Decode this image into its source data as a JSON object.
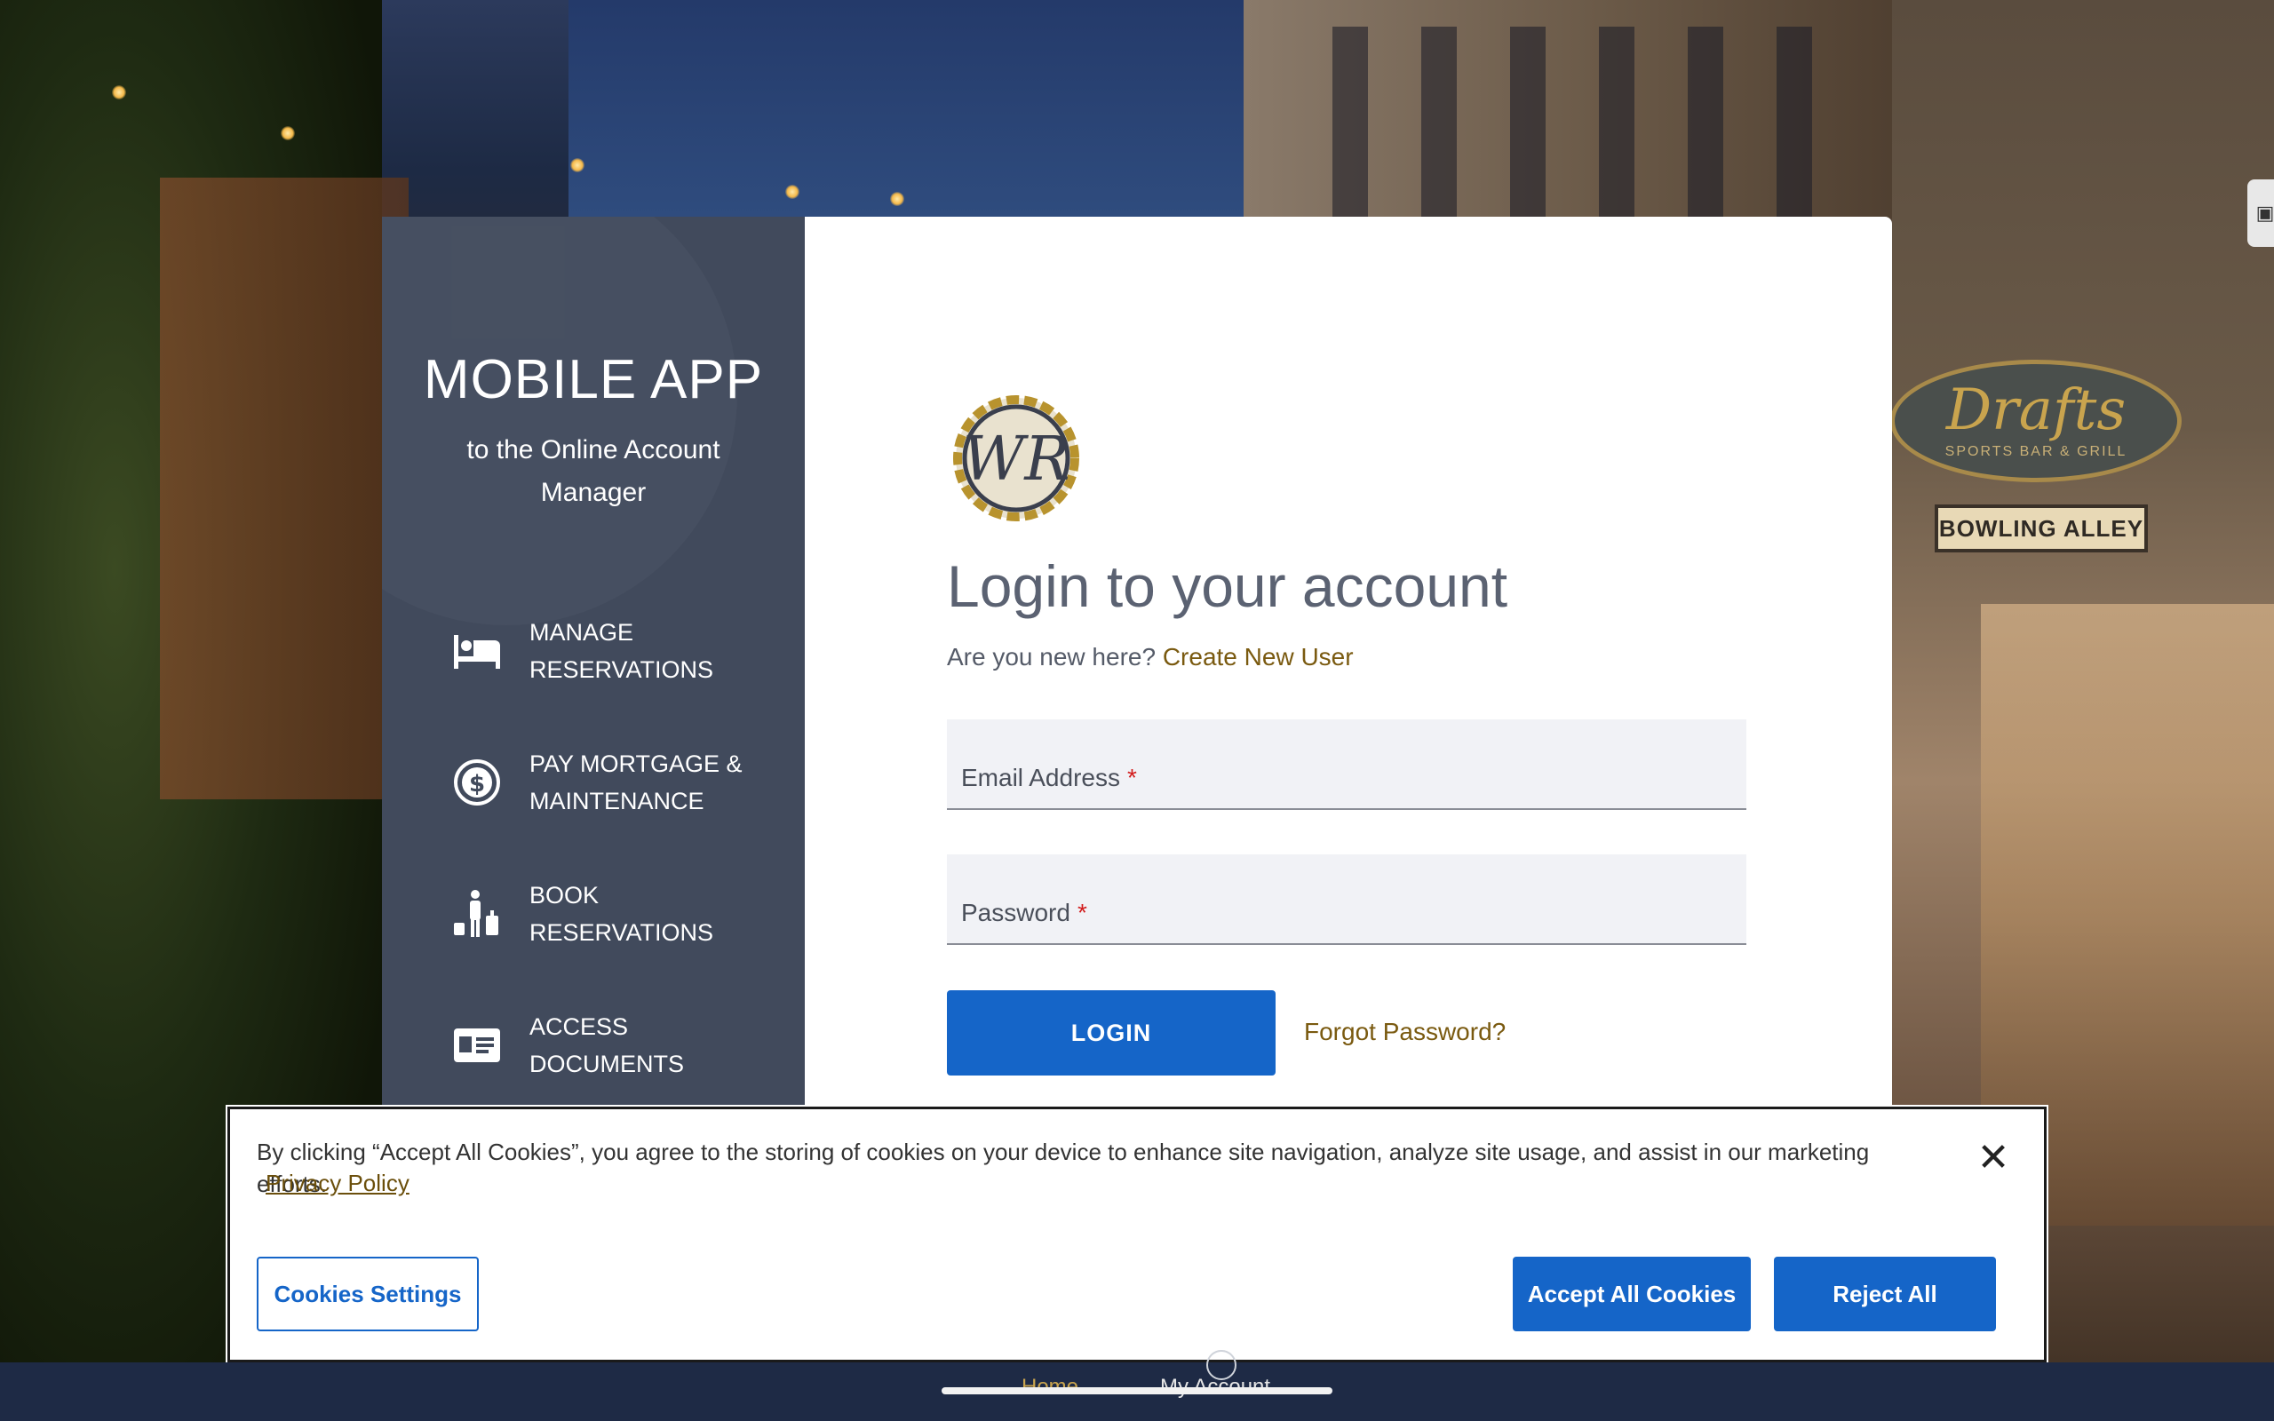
{
  "sidebar": {
    "title": "MOBILE APP",
    "subtitle": "to the Online Account Manager",
    "features": [
      {
        "label": "MANAGE RESERVATIONS",
        "icon": "bed-icon"
      },
      {
        "label": "PAY MORTGAGE & MAINTENANCE",
        "icon": "dollar-circle-icon"
      },
      {
        "label": "BOOK RESERVATIONS",
        "icon": "traveler-luggage-icon"
      },
      {
        "label": "ACCESS DOCUMENTS",
        "icon": "id-card-icon"
      }
    ]
  },
  "login": {
    "logo_text": "WR",
    "heading": "Login to your account",
    "new_here": "Are you new here?",
    "create_user": "Create New User",
    "email_label": "Email Address",
    "password_label": "Password",
    "required_mark": "*",
    "login_button": "LOGIN",
    "forgot_password": "Forgot Password?"
  },
  "cookie": {
    "message": "By clicking “Accept All Cookies”, you agree to the storing of cookies on your device to enhance site navigation, analyze site usage, and assist in our marketing efforts.",
    "privacy_policy": "Privacy Policy",
    "close_symbol": "✕",
    "settings_button": "Cookies Settings",
    "accept_button": "Accept All Cookies",
    "reject_button": "Reject All"
  },
  "background": {
    "sign_name": "Drafts",
    "sign_tagline": "SPORTS BAR & GRILL",
    "sign_secondary": "BOWLING ALLEY"
  },
  "bottom_nav": {
    "home": "Home",
    "account": "My Account"
  },
  "colors": {
    "sidebar_bg": "#414a5c",
    "primary_button": "#1565c8",
    "link_gold": "#7a5a10",
    "required_red": "#d21c1c",
    "bottom_bar": "#1e2a45"
  }
}
